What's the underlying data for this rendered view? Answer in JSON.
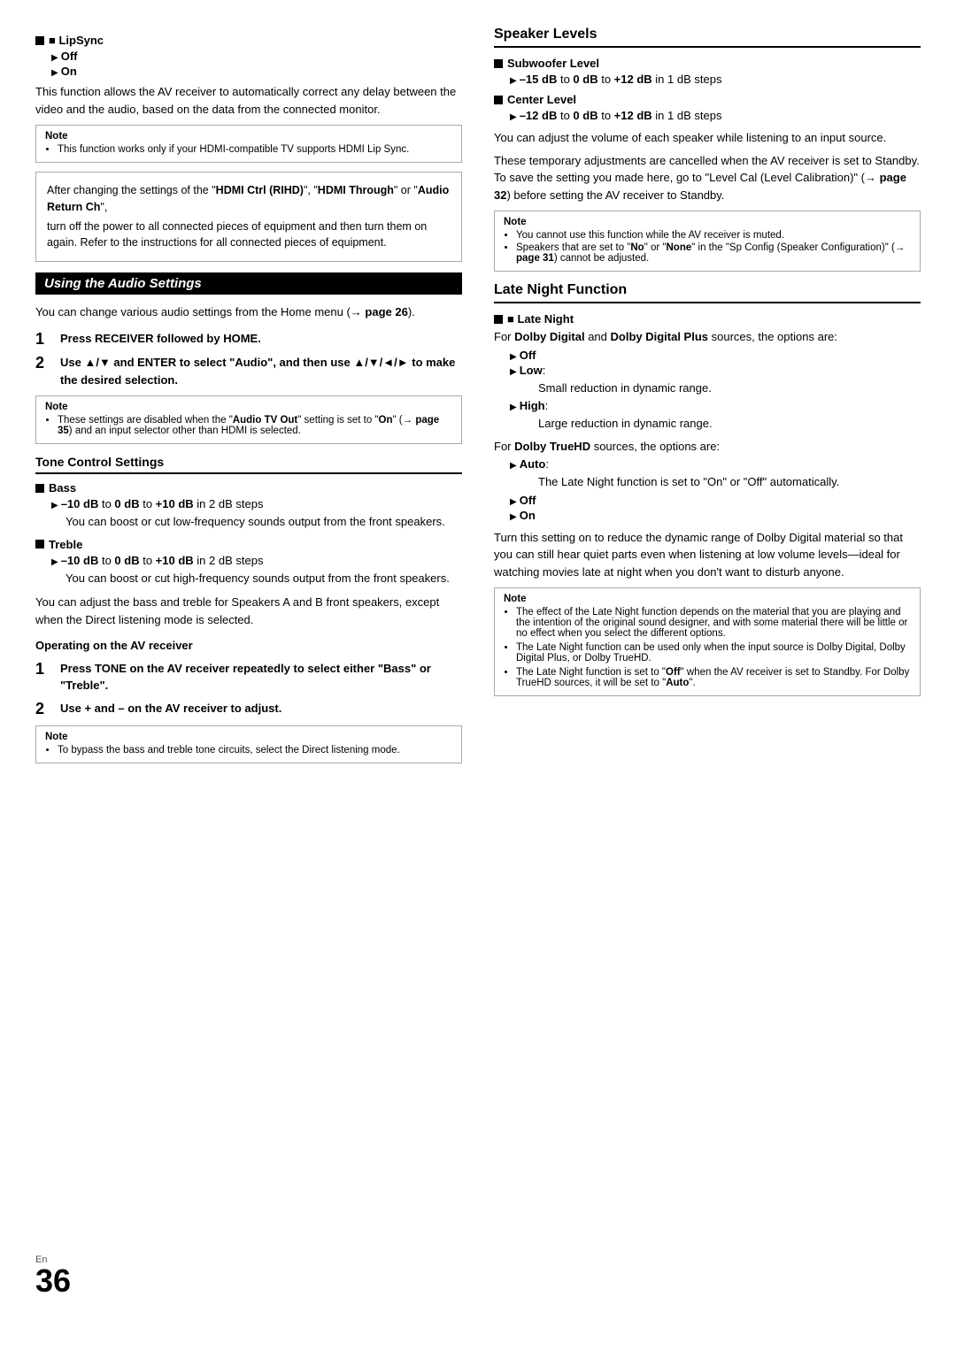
{
  "page": {
    "number": "36",
    "en_label": "En"
  },
  "left_col": {
    "lipsync": {
      "title": "■ LipSync",
      "off_label": "Off",
      "on_label": "On",
      "description": "This function allows the AV receiver to automatically correct any delay between the video and the audio, based on the data from the connected monitor.",
      "note_title": "Note",
      "note_text": "This function works only if your HDMI-compatible TV supports HDMI Lip Sync."
    },
    "warning_box": {
      "line1": "After changing the settings of the \"HDMI Ctrl (RIHD)\", \"HDMI Through\" or \"Audio Return Ch\",",
      "line2": "turn off the power to all connected pieces of equipment and then turn them on again. Refer to the instructions for all connected pieces of equipment."
    },
    "using_audio": {
      "title": "Using the Audio Settings",
      "intro": "You can change various audio settings from the Home menu (→ page 26).",
      "step1": {
        "num": "1",
        "text": "Press RECEIVER followed by HOME."
      },
      "step2": {
        "num": "2",
        "text": "Use ▲/▼ and ENTER to select \"Audio\", and then use ▲/▼/◄/► to make the desired selection."
      },
      "note_title": "Note",
      "note_items": [
        "These settings are disabled when the \"Audio TV Out\" setting is set to \"On\" (→ page 35) and an input selector other than HDMI is selected."
      ]
    },
    "tone_control": {
      "title": "Tone Control Settings",
      "bass": {
        "label": "■ Bass",
        "range": "–10 dB to 0 dB to +10 dB in 2 dB steps",
        "description": "You can boost or cut low-frequency sounds output from the front speakers."
      },
      "treble": {
        "label": "■ Treble",
        "range": "–10 dB to 0 dB to +10 dB in 2 dB steps",
        "description": "You can boost or cut high-frequency sounds output from the front speakers."
      },
      "footer_text": "You can adjust the bass and treble for Speakers A and B front speakers, except when the Direct listening mode is selected.",
      "operating_header": "Operating on the AV receiver",
      "step1": {
        "num": "1",
        "text": "Press TONE on the AV receiver repeatedly to select either \"Bass\" or \"Treble\"."
      },
      "step2": {
        "num": "2",
        "text": "Use + and – on the AV receiver to adjust."
      },
      "note_title": "Note",
      "note_items": [
        "To bypass the bass and treble tone circuits, select the Direct listening mode."
      ]
    }
  },
  "right_col": {
    "speaker_levels": {
      "title": "Speaker Levels",
      "subwoofer": {
        "label": "■ Subwoofer Level",
        "range": "–15 dB to 0 dB to +12 dB in 1 dB steps"
      },
      "center": {
        "label": "■ Center Level",
        "range": "–12 dB to 0 dB to +12 dB in 1 dB steps"
      },
      "desc1": "You can adjust the volume of each speaker while listening to an input source.",
      "desc2": "These temporary adjustments are cancelled when the AV receiver is set to Standby. To save the setting you made here, go to \"Level Cal (Level Calibration)\" (→ page 32) before setting the AV receiver to Standby.",
      "note_title": "Note",
      "note_items": [
        "You cannot use this function while the AV receiver is muted.",
        "Speakers that are set to \"No\" or \"None\" in the \"Sp Config (Speaker Configuration)\" (→ page 31) cannot be adjusted."
      ]
    },
    "late_night": {
      "title": "Late Night Function",
      "late_night_label": "■ Late Night",
      "dolby_intro": "For Dolby Digital and Dolby Digital Plus sources, the options are:",
      "options_dolby": [
        {
          "label": "Off"
        },
        {
          "label": "Low:",
          "desc": "Small reduction in dynamic range."
        },
        {
          "label": "High",
          "desc": "Large reduction in dynamic range."
        }
      ],
      "truehd_intro": "For Dolby TrueHD sources, the options are:",
      "options_truehd": [
        {
          "label": "Auto:",
          "desc": "The Late Night function is set to \"On\" or \"Off\" automatically."
        },
        {
          "label": "Off"
        },
        {
          "label": "On"
        }
      ],
      "main_desc": "Turn this setting on to reduce the dynamic range of Dolby Digital material so that you can still hear quiet parts even when listening at low volume levels—ideal for watching movies late at night when you don't want to disturb anyone.",
      "note_title": "Note",
      "note_items": [
        "The effect of the Late Night function depends on the material that you are playing and the intention of the original sound designer, and with some material there will be little or no effect when you select the different options.",
        "The Late Night function can be used only when the input source is Dolby Digital, Dolby Digital Plus, or Dolby TrueHD.",
        "The Late Night function is set to \"Off\" when the AV receiver is set to Standby. For Dolby TrueHD sources, it will be set to \"Auto\"."
      ]
    }
  }
}
